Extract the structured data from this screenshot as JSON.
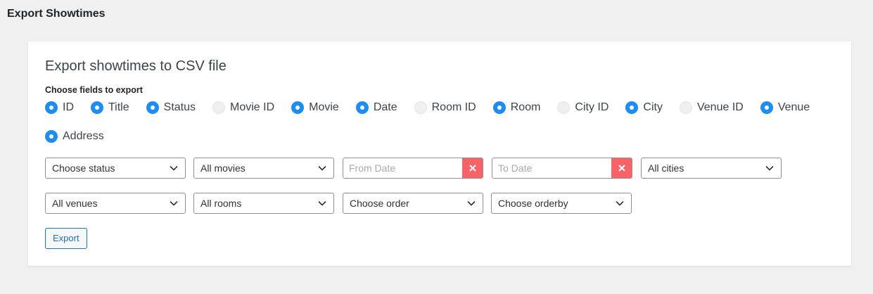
{
  "page": {
    "title": "Export Showtimes"
  },
  "panel": {
    "heading": "Export showtimes to CSV file",
    "fields_label": "Choose fields to export",
    "fields": [
      {
        "label": "ID",
        "selected": true
      },
      {
        "label": "Title",
        "selected": true
      },
      {
        "label": "Status",
        "selected": true
      },
      {
        "label": "Movie ID",
        "selected": false
      },
      {
        "label": "Movie",
        "selected": true
      },
      {
        "label": "Date",
        "selected": true
      },
      {
        "label": "Room ID",
        "selected": false
      },
      {
        "label": "Room",
        "selected": true
      },
      {
        "label": "City ID",
        "selected": false
      },
      {
        "label": "City",
        "selected": true
      },
      {
        "label": "Venue ID",
        "selected": false
      },
      {
        "label": "Venue",
        "selected": true
      },
      {
        "label": "Address",
        "selected": true
      }
    ],
    "filters": {
      "status": "Choose status",
      "movies": "All movies",
      "from_date_placeholder": "From Date",
      "to_date_placeholder": "To Date",
      "cities": "All cities",
      "venues": "All venues",
      "rooms": "All rooms",
      "order": "Choose order",
      "orderby": "Choose orderby"
    },
    "export_label": "Export"
  },
  "colors": {
    "accent": "#1e8cf0",
    "clear_button": "#f86368",
    "link_blue": "#2271b1",
    "background": "#f0f0f1"
  },
  "icons": {
    "select_arrow": "chevron-down-icon",
    "date_clear": "close-icon"
  }
}
